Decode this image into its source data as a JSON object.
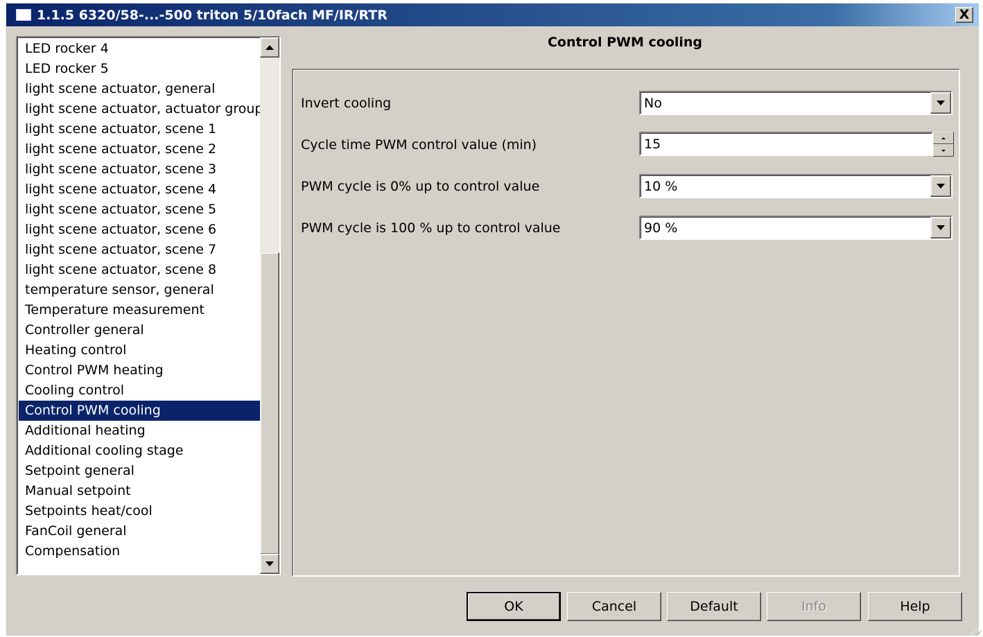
{
  "window": {
    "title": "1.1.5 6320/58-...-500 triton 5/10fach MF/IR/RTR",
    "close_label": "X"
  },
  "tree": {
    "items": [
      "LED rocker 4",
      "LED rocker 5",
      "light scene actuator, general",
      "light scene actuator, actuator groups",
      "light scene actuator, scene 1",
      "light scene actuator, scene 2",
      "light scene actuator, scene 3",
      "light scene actuator, scene 4",
      "light scene actuator, scene 5",
      "light scene actuator, scene 6",
      "light scene actuator, scene 7",
      "light scene actuator, scene 8",
      "temperature sensor, general",
      "Temperature measurement",
      "Controller general",
      "Heating control",
      "Control PWM heating",
      "Cooling control",
      "Control PWM cooling",
      "Additional heating",
      "Additional cooling stage",
      "Setpoint general",
      "Manual setpoint",
      "Setpoints heat/cool",
      "FanCoil general",
      "Compensation"
    ],
    "selected_index": 18
  },
  "panel": {
    "title": "Control PWM cooling",
    "params": [
      {
        "label": "Invert cooling",
        "value": "No",
        "control": "dropdown"
      },
      {
        "label": "Cycle time PWM control value (min)",
        "value": "15",
        "control": "spinner"
      },
      {
        "label": "PWM cycle is 0% up to control value",
        "value": "10 %",
        "control": "dropdown"
      },
      {
        "label": "PWM cycle is 100 % up to control value",
        "value": "90 %",
        "control": "dropdown"
      }
    ]
  },
  "buttons": {
    "ok": "OK",
    "cancel": "Cancel",
    "default": "Default",
    "info": "Info",
    "help": "Help"
  },
  "colors": {
    "titlebar_start": "#0a246a",
    "selection": "#0a246a",
    "face": "#d4d0c8"
  }
}
